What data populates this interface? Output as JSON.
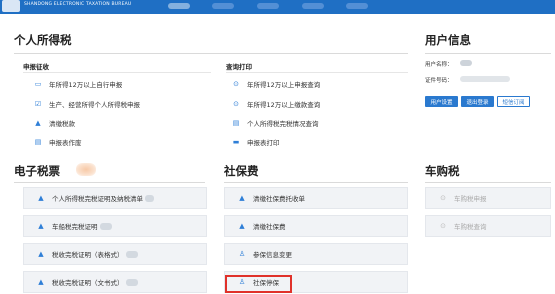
{
  "header": {
    "bureau_name": "SHANDONG ELECTRONIC TAXATION BUREAU",
    "colors": {
      "bar": "#1f6fc4",
      "accent": "#2f7fd7",
      "highlight": "#e0312a"
    }
  },
  "personal_income_tax": {
    "title": "个人所得税",
    "declare": {
      "heading": "申报征收",
      "items": [
        {
          "label": "年所得12万以上自行申报",
          "icon": "monitor-icon"
        },
        {
          "label": "生产、经营所得个人所得税申报",
          "icon": "checkbox-icon"
        },
        {
          "label": "清缴税款",
          "icon": "payment-icon"
        },
        {
          "label": "申报表作废",
          "icon": "document-icon"
        }
      ]
    },
    "query": {
      "heading": "查询打印",
      "items": [
        {
          "label": "年所得12万以上申报查询",
          "icon": "search-icon"
        },
        {
          "label": "年所得12万以上缴款查询",
          "icon": "search-icon"
        },
        {
          "label": "个人所得税完税情况查询",
          "icon": "document-icon"
        },
        {
          "label": "申报表打印",
          "icon": "printer-icon"
        }
      ]
    }
  },
  "user_info": {
    "title": "用户信息",
    "username_label": "用户名称：",
    "id_label": "证件号码：",
    "buttons": {
      "settings": "用户设置",
      "logout": "退出登录",
      "sms": "短信订阅"
    }
  },
  "e_tax_ticket": {
    "title": "电子税票",
    "items": [
      {
        "label": "个人所得税完税证明及纳税清单",
        "icon": "payment-icon"
      },
      {
        "label": "车船税完税证明",
        "icon": "payment-icon"
      },
      {
        "label": "税收完税证明（表格式）",
        "icon": "payment-icon"
      },
      {
        "label": "税收完税证明（文书式）",
        "icon": "payment-icon"
      }
    ]
  },
  "social_security": {
    "title": "社保费",
    "items": [
      {
        "label": "清缴社保费托收单",
        "icon": "payment-icon"
      },
      {
        "label": "清缴社保费",
        "icon": "payment-icon"
      },
      {
        "label": "参保信息变更",
        "icon": "user-icon"
      },
      {
        "label": "社保停保",
        "icon": "user-icon"
      }
    ]
  },
  "vehicle_purchase_tax": {
    "title": "车购税",
    "items": [
      {
        "label": "车购税申报",
        "icon": "search-icon"
      },
      {
        "label": "车购税查询",
        "icon": "search-icon"
      }
    ]
  }
}
